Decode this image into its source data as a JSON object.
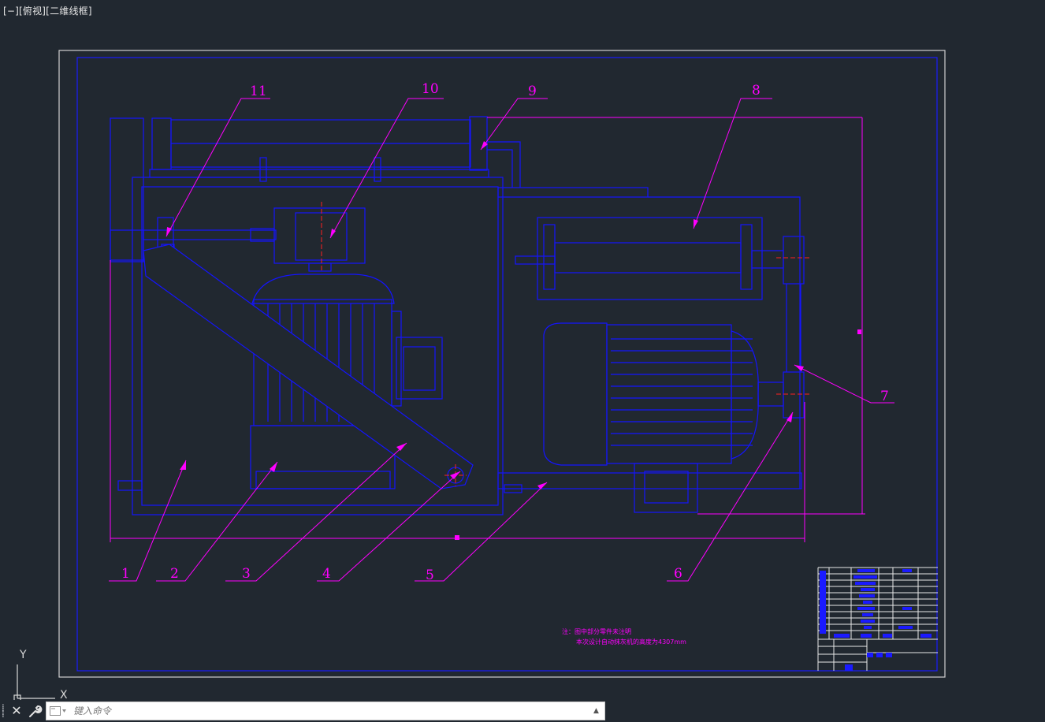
{
  "viewport": {
    "label": "[−][俯视][二维线框]"
  },
  "drawing": {
    "callouts": [
      "1",
      "2",
      "3",
      "4",
      "5",
      "6",
      "7",
      "8",
      "9",
      "10",
      "11"
    ],
    "notes": [
      "注：图中部分零件未注明",
      "本次设计自动抹灰机的高度为4307mm"
    ]
  },
  "ucs": {
    "y": "Y",
    "x": "X"
  },
  "command_line": {
    "placeholder": "键入命令",
    "close_symbol": "✕",
    "history_symbol": "▲"
  },
  "colors": {
    "background": "#212830",
    "geometry": "#0000ff",
    "annotation": "#ff00ff",
    "centerline": "#ff0000",
    "frame": "#ffffff"
  }
}
